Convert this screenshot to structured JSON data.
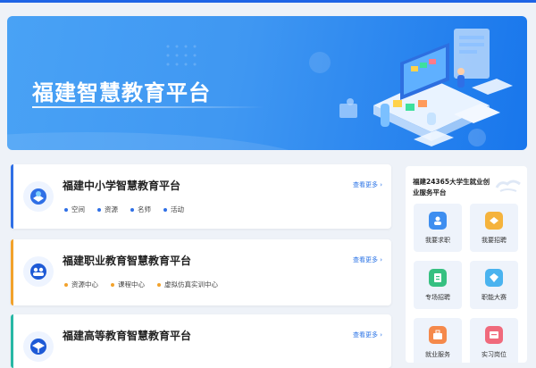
{
  "banner": {
    "title": "福建智慧教育平台"
  },
  "platforms": [
    {
      "title": "福建中小学智慧教育平台",
      "more": "查看更多 ›",
      "accent": "#2f6fe6",
      "tags": [
        "空间",
        "资源",
        "名师",
        "活动"
      ]
    },
    {
      "title": "福建职业教育智慧教育平台",
      "more": "查看更多 ›",
      "accent": "#f2a22b",
      "tags": [
        "资源中心",
        "课程中心",
        "虚拟仿真实训中心"
      ]
    },
    {
      "title": "福建高等教育智慧教育平台",
      "more": "查看更多 ›",
      "accent": "#27b8a5",
      "tags": []
    }
  ],
  "side": {
    "title": "福建24365大学生就业创业服务平台",
    "tiles": [
      {
        "label": "我要求职",
        "icon": "job-seek-icon",
        "color": "#3e8ef0"
      },
      {
        "label": "我要招聘",
        "icon": "recruit-icon",
        "color": "#f5b33c"
      },
      {
        "label": "专场招聘",
        "icon": "special-recruit-icon",
        "color": "#36c081"
      },
      {
        "label": "职能大赛",
        "icon": "contest-icon",
        "color": "#4ab3ef"
      },
      {
        "label": "就业服务",
        "icon": "employment-service-icon",
        "color": "#f5894b"
      },
      {
        "label": "实习岗位",
        "icon": "internship-icon",
        "color": "#f06a7c"
      }
    ]
  },
  "colors": {
    "brand": "#1e64e6",
    "page_bg": "#eef2f8"
  }
}
